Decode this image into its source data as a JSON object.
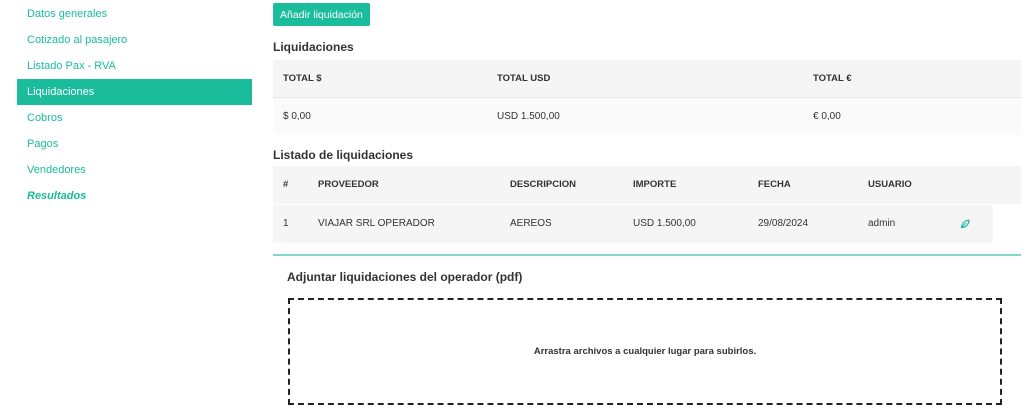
{
  "sidebar": {
    "items": [
      {
        "label": "Datos generales"
      },
      {
        "label": "Cotizado al pasajero"
      },
      {
        "label": "Listado Pax - RVA"
      },
      {
        "label": "Liquidaciones"
      },
      {
        "label": "Cobros"
      },
      {
        "label": "Pagos"
      },
      {
        "label": "Vendedores"
      },
      {
        "label": "Resultados"
      }
    ],
    "active": "Liquidaciones"
  },
  "toolbar": {
    "add_label": "Añadir liquidación"
  },
  "totals": {
    "title": "Liquidaciones",
    "headers": [
      "TOTAL $",
      "TOTAL USD",
      "TOTAL €"
    ],
    "values": [
      "$ 0,00",
      "USD 1.500,00",
      "€ 0,00"
    ]
  },
  "listing": {
    "title": "Listado de liquidaciones",
    "headers": [
      "#",
      "PROVEEDOR",
      "DESCRIPCION",
      "IMPORTE",
      "FECHA",
      "USUARIO"
    ],
    "rows": [
      {
        "num": "1",
        "proveedor": "VIAJAR SRL OPERADOR",
        "descripcion": "AEREOS",
        "importe": "USD 1.500,00",
        "fecha": "29/08/2024",
        "usuario": "admin",
        "action_icon": "leaf-icon"
      }
    ]
  },
  "attach": {
    "title": "Adjuntar liquidaciones del operador (pdf)",
    "dropzone_text": "Arrastra archivos a cualquier lugar para subirlos."
  },
  "colors": {
    "accent": "#1abc9c"
  }
}
